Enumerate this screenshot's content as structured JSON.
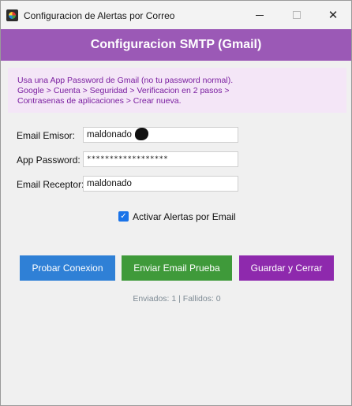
{
  "window": {
    "title": "Configuracion de Alertas por Correo",
    "minimize_icon": "minimize-icon",
    "maximize_icon": "maximize-icon",
    "close_icon": "close-icon",
    "close_glyph": "✕"
  },
  "header": {
    "title": "Configuracion SMTP (Gmail)",
    "color": "#9b59b6"
  },
  "info": {
    "line1": "Usa una App Password de Gmail (no tu password normal).",
    "line2": "Google > Cuenta > Seguridad > Verificacion en 2 pasos >",
    "line3": "Contrasenas de aplicaciones > Crear nueva.",
    "text_color": "#7a1ea0",
    "background": "#f4e6f7"
  },
  "form": {
    "emisor_label": "Email Emisor:",
    "emisor_value": "maldonado",
    "password_label": "App Password:",
    "password_value": "******************",
    "receptor_label": "Email Receptor:",
    "receptor_value": "maldonado"
  },
  "alerts": {
    "checkbox_label": "Activar Alertas por Email",
    "checked": true,
    "check_glyph": "✓"
  },
  "buttons": {
    "probar": "Probar Conexion",
    "enviar": "Enviar Email Prueba",
    "guardar": "Guardar y Cerrar",
    "probar_color": "#2f80d6",
    "enviar_color": "#3f9a3a",
    "guardar_color": "#8e29ad"
  },
  "status": {
    "text": "Enviados: 1 | Fallidos: 0"
  }
}
